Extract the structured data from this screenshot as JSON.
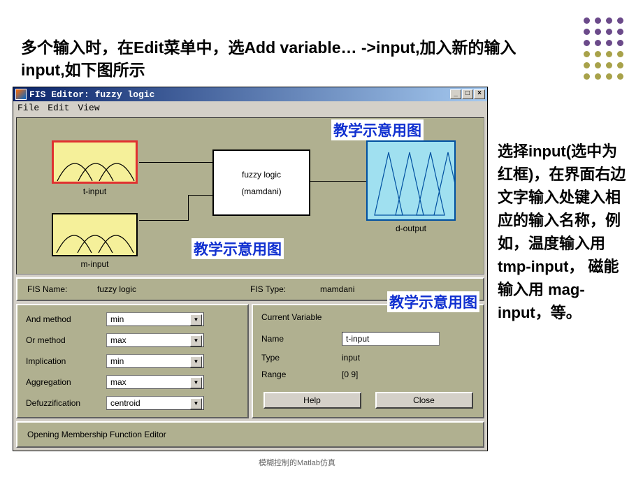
{
  "intro": "多个输入时，在Edit菜单中，选Add variable… ->input,加入新的输入input,如下图所示",
  "side": "选择input(选中为红框)，在界面右边文字输入处键入相应的输入名称，例如，温度输入用 tmp-input， 磁能输入用 mag-input，等。",
  "window": {
    "title": "FIS Editor: fuzzy logic",
    "menu": {
      "file": "File",
      "edit": "Edit",
      "view": "View"
    }
  },
  "blocks": {
    "input1": "t-input",
    "input2": "m-input",
    "center_name": "fuzzy logic",
    "center_type": "(mamdani)",
    "output": "d-output"
  },
  "watermark": "教学示意用图",
  "info": {
    "fis_name_label": "FIS Name:",
    "fis_name": "fuzzy logic",
    "fis_type_label": "FIS Type:",
    "fis_type": "mamdani"
  },
  "methods": {
    "and_label": "And method",
    "and": "min",
    "or_label": "Or method",
    "or": "max",
    "imp_label": "Implication",
    "imp": "min",
    "agg_label": "Aggregation",
    "agg": "max",
    "defuzz_label": "Defuzzification",
    "defuzz": "centroid"
  },
  "currentvar": {
    "title": "Current Variable",
    "name_label": "Name",
    "name": "t-input",
    "type_label": "Type",
    "type": "input",
    "range_label": "Range",
    "range": "[0 9]"
  },
  "buttons": {
    "help": "Help",
    "close": "Close"
  },
  "status": "Opening Membership Function Editor",
  "footer": "模糊控制的Matlab仿真"
}
